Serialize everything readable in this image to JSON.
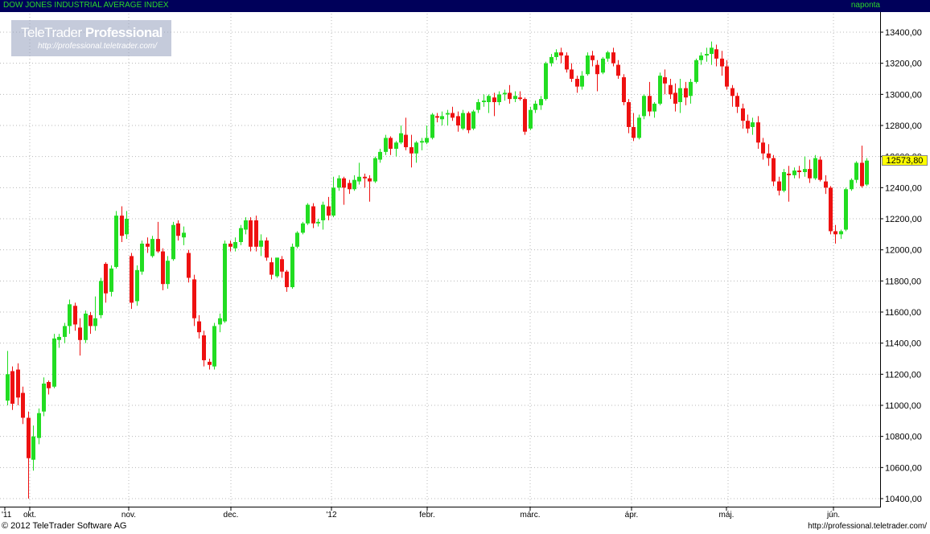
{
  "header": {
    "title": "DOW JONES INDUSTRIAL AVERAGE INDEX",
    "interval": "naponta"
  },
  "watermark": {
    "brand_plain": "TeleTrader",
    "brand_bold": "Professional",
    "url": "http://professional.teletrader.com/"
  },
  "footer": {
    "copyright": "© 2012 TeleTrader Software AG",
    "url": "http://professional.teletrader.com/"
  },
  "colors": {
    "up": "#22dd22",
    "down": "#ee1111",
    "grid": "#b8b8b8",
    "header_bg": "#00005a",
    "header_text": "#2bd62b",
    "last_price_bg": "#ffff00"
  },
  "chart_data": {
    "type": "candlestick",
    "title": "DOW JONES INDUSTRIAL AVERAGE INDEX",
    "ylim": [
      10400,
      13500
    ],
    "y_ticks": [
      "13400,00",
      "13200,00",
      "13000,00",
      "12800,00",
      "12600,00",
      "12400,00",
      "12200,00",
      "12000,00",
      "11800,00",
      "11600,00",
      "11400,00",
      "11200,00",
      "11000,00",
      "10800,00",
      "10600,00",
      "10400,00"
    ],
    "x_labels": [
      "'11",
      "okt.",
      "nov.",
      "dec.",
      "'12",
      "febr.",
      "márc.",
      "ápr.",
      "máj.",
      "jún."
    ],
    "last_price": "12573,80",
    "grid": true,
    "candles": [
      {
        "o": 11030,
        "h": 11350,
        "l": 11000,
        "c": 11200
      },
      {
        "o": 11220,
        "h": 11250,
        "l": 10970,
        "c": 11010
      },
      {
        "o": 11230,
        "h": 11270,
        "l": 11000,
        "c": 11050
      },
      {
        "o": 11080,
        "h": 11120,
        "l": 10880,
        "c": 10920
      },
      {
        "o": 10920,
        "h": 10960,
        "l": 10400,
        "c": 10660
      },
      {
        "o": 10650,
        "h": 10870,
        "l": 10580,
        "c": 10800
      },
      {
        "o": 10790,
        "h": 10980,
        "l": 10750,
        "c": 10950
      },
      {
        "o": 10960,
        "h": 11180,
        "l": 10930,
        "c": 11140
      },
      {
        "o": 11150,
        "h": 11160,
        "l": 11070,
        "c": 11110
      },
      {
        "o": 11120,
        "h": 11460,
        "l": 11110,
        "c": 11430
      },
      {
        "o": 11420,
        "h": 11460,
        "l": 11370,
        "c": 11440
      },
      {
        "o": 11440,
        "h": 11530,
        "l": 11400,
        "c": 11510
      },
      {
        "o": 11510,
        "h": 11680,
        "l": 11460,
        "c": 11650
      },
      {
        "o": 11640,
        "h": 11660,
        "l": 11480,
        "c": 11520
      },
      {
        "o": 11500,
        "h": 11560,
        "l": 11320,
        "c": 11420
      },
      {
        "o": 11420,
        "h": 11610,
        "l": 11400,
        "c": 11590
      },
      {
        "o": 11580,
        "h": 11600,
        "l": 11460,
        "c": 11510
      },
      {
        "o": 11510,
        "h": 11700,
        "l": 11480,
        "c": 11560
      },
      {
        "o": 11580,
        "h": 11820,
        "l": 11560,
        "c": 11800
      },
      {
        "o": 11910,
        "h": 11920,
        "l": 11660,
        "c": 11720
      },
      {
        "o": 11730,
        "h": 11900,
        "l": 11700,
        "c": 11880
      },
      {
        "o": 11890,
        "h": 12250,
        "l": 11880,
        "c": 12220
      },
      {
        "o": 12220,
        "h": 12280,
        "l": 12050,
        "c": 12090
      },
      {
        "o": 12100,
        "h": 12250,
        "l": 12070,
        "c": 12200
      },
      {
        "o": 11960,
        "h": 11980,
        "l": 11620,
        "c": 11660
      },
      {
        "o": 11670,
        "h": 11900,
        "l": 11640,
        "c": 11870
      },
      {
        "o": 11860,
        "h": 12060,
        "l": 11840,
        "c": 12040
      },
      {
        "o": 12040,
        "h": 12080,
        "l": 11980,
        "c": 12020
      },
      {
        "o": 11960,
        "h": 12090,
        "l": 11950,
        "c": 12070
      },
      {
        "o": 12070,
        "h": 12180,
        "l": 11980,
        "c": 11990
      },
      {
        "o": 11990,
        "h": 12010,
        "l": 11740,
        "c": 11780
      },
      {
        "o": 11780,
        "h": 11960,
        "l": 11750,
        "c": 11930
      },
      {
        "o": 11940,
        "h": 12180,
        "l": 11930,
        "c": 12160
      },
      {
        "o": 12170,
        "h": 12190,
        "l": 12060,
        "c": 12090
      },
      {
        "o": 12080,
        "h": 12150,
        "l": 12030,
        "c": 12110
      },
      {
        "o": 11980,
        "h": 12000,
        "l": 11790,
        "c": 11820
      },
      {
        "o": 11810,
        "h": 11840,
        "l": 11510,
        "c": 11560
      },
      {
        "o": 11540,
        "h": 11580,
        "l": 11430,
        "c": 11470
      },
      {
        "o": 11450,
        "h": 11480,
        "l": 11250,
        "c": 11290
      },
      {
        "o": 11280,
        "h": 11300,
        "l": 11230,
        "c": 11260
      },
      {
        "o": 11250,
        "h": 11530,
        "l": 11230,
        "c": 11510
      },
      {
        "o": 11520,
        "h": 11590,
        "l": 11470,
        "c": 11560
      },
      {
        "o": 11540,
        "h": 12060,
        "l": 11530,
        "c": 12040
      },
      {
        "o": 12040,
        "h": 12060,
        "l": 11990,
        "c": 12020
      },
      {
        "o": 12010,
        "h": 12080,
        "l": 11990,
        "c": 12050
      },
      {
        "o": 12050,
        "h": 12160,
        "l": 12030,
        "c": 12140
      },
      {
        "o": 12130,
        "h": 12210,
        "l": 12100,
        "c": 12190
      },
      {
        "o": 12190,
        "h": 12210,
        "l": 11990,
        "c": 12020
      },
      {
        "o": 12190,
        "h": 12220,
        "l": 11990,
        "c": 12020
      },
      {
        "o": 12020,
        "h": 12100,
        "l": 11960,
        "c": 12060
      },
      {
        "o": 12060,
        "h": 12080,
        "l": 11930,
        "c": 11950
      },
      {
        "o": 11920,
        "h": 11950,
        "l": 11810,
        "c": 11840
      },
      {
        "o": 11830,
        "h": 11950,
        "l": 11820,
        "c": 11950
      },
      {
        "o": 11940,
        "h": 11960,
        "l": 11820,
        "c": 11860
      },
      {
        "o": 11860,
        "h": 11870,
        "l": 11730,
        "c": 11760
      },
      {
        "o": 11760,
        "h": 12040,
        "l": 11750,
        "c": 12020
      },
      {
        "o": 12020,
        "h": 12120,
        "l": 12010,
        "c": 12110
      },
      {
        "o": 12110,
        "h": 12180,
        "l": 12100,
        "c": 12170
      },
      {
        "o": 12170,
        "h": 12300,
        "l": 12160,
        "c": 12290
      },
      {
        "o": 12280,
        "h": 12300,
        "l": 12140,
        "c": 12170
      },
      {
        "o": 12170,
        "h": 12200,
        "l": 12150,
        "c": 12180
      },
      {
        "o": 12190,
        "h": 12310,
        "l": 12130,
        "c": 12290
      },
      {
        "o": 12280,
        "h": 12340,
        "l": 12190,
        "c": 12220
      },
      {
        "o": 12220,
        "h": 12470,
        "l": 12210,
        "c": 12400
      },
      {
        "o": 12400,
        "h": 12480,
        "l": 12380,
        "c": 12460
      },
      {
        "o": 12460,
        "h": 12470,
        "l": 12290,
        "c": 12400
      },
      {
        "o": 12430,
        "h": 12450,
        "l": 12360,
        "c": 12390
      },
      {
        "o": 12390,
        "h": 12480,
        "l": 12380,
        "c": 12450
      },
      {
        "o": 12440,
        "h": 12560,
        "l": 12420,
        "c": 12470
      },
      {
        "o": 12470,
        "h": 12490,
        "l": 12400,
        "c": 12460
      },
      {
        "o": 12460,
        "h": 12480,
        "l": 12310,
        "c": 12440
      },
      {
        "o": 12440,
        "h": 12600,
        "l": 12430,
        "c": 12590
      },
      {
        "o": 12580,
        "h": 12650,
        "l": 12560,
        "c": 12630
      },
      {
        "o": 12630,
        "h": 12740,
        "l": 12610,
        "c": 12720
      },
      {
        "o": 12720,
        "h": 12730,
        "l": 12610,
        "c": 12650
      },
      {
        "o": 12650,
        "h": 12700,
        "l": 12600,
        "c": 12690
      },
      {
        "o": 12690,
        "h": 12800,
        "l": 12680,
        "c": 12750
      },
      {
        "o": 12740,
        "h": 12850,
        "l": 12640,
        "c": 12660
      },
      {
        "o": 12660,
        "h": 12740,
        "l": 12530,
        "c": 12620
      },
      {
        "o": 12620,
        "h": 12700,
        "l": 12560,
        "c": 12690
      },
      {
        "o": 12690,
        "h": 12720,
        "l": 12640,
        "c": 12700
      },
      {
        "o": 12690,
        "h": 12800,
        "l": 12680,
        "c": 12720
      },
      {
        "o": 12720,
        "h": 12880,
        "l": 12710,
        "c": 12870
      },
      {
        "o": 12860,
        "h": 12880,
        "l": 12820,
        "c": 12850
      },
      {
        "o": 12840,
        "h": 12890,
        "l": 12800,
        "c": 12860
      },
      {
        "o": 12870,
        "h": 12900,
        "l": 12800,
        "c": 12880
      },
      {
        "o": 12880,
        "h": 12920,
        "l": 12830,
        "c": 12850
      },
      {
        "o": 12860,
        "h": 12890,
        "l": 12760,
        "c": 12800
      },
      {
        "o": 12780,
        "h": 12900,
        "l": 12770,
        "c": 12880
      },
      {
        "o": 12880,
        "h": 12890,
        "l": 12750,
        "c": 12770
      },
      {
        "o": 12780,
        "h": 12900,
        "l": 12770,
        "c": 12890
      },
      {
        "o": 12900,
        "h": 12970,
        "l": 12880,
        "c": 12950
      },
      {
        "o": 12950,
        "h": 13000,
        "l": 12920,
        "c": 12960
      },
      {
        "o": 12950,
        "h": 13000,
        "l": 12880,
        "c": 12990
      },
      {
        "o": 12980,
        "h": 13010,
        "l": 12860,
        "c": 12950
      },
      {
        "o": 12950,
        "h": 13020,
        "l": 12930,
        "c": 13000
      },
      {
        "o": 13000,
        "h": 13030,
        "l": 12960,
        "c": 13010
      },
      {
        "o": 13010,
        "h": 13060,
        "l": 12940,
        "c": 12970
      },
      {
        "o": 12970,
        "h": 13020,
        "l": 12950,
        "c": 12990
      },
      {
        "o": 12980,
        "h": 13020,
        "l": 12960,
        "c": 12970
      },
      {
        "o": 12970,
        "h": 12980,
        "l": 12740,
        "c": 12760
      },
      {
        "o": 12780,
        "h": 12920,
        "l": 12770,
        "c": 12900
      },
      {
        "o": 12900,
        "h": 12960,
        "l": 12880,
        "c": 12940
      },
      {
        "o": 12930,
        "h": 12990,
        "l": 12900,
        "c": 12970
      },
      {
        "o": 12970,
        "h": 13210,
        "l": 12960,
        "c": 13200
      },
      {
        "o": 13200,
        "h": 13260,
        "l": 13180,
        "c": 13240
      },
      {
        "o": 13240,
        "h": 13290,
        "l": 13220,
        "c": 13270
      },
      {
        "o": 13270,
        "h": 13300,
        "l": 13200,
        "c": 13250
      },
      {
        "o": 13250,
        "h": 13270,
        "l": 13140,
        "c": 13160
      },
      {
        "o": 13160,
        "h": 13200,
        "l": 13080,
        "c": 13100
      },
      {
        "o": 13100,
        "h": 13120,
        "l": 13010,
        "c": 13050
      },
      {
        "o": 13050,
        "h": 13150,
        "l": 13030,
        "c": 13120
      },
      {
        "o": 13130,
        "h": 13270,
        "l": 13120,
        "c": 13250
      },
      {
        "o": 13250,
        "h": 13280,
        "l": 13180,
        "c": 13220
      },
      {
        "o": 13190,
        "h": 13220,
        "l": 13020,
        "c": 13130
      },
      {
        "o": 13140,
        "h": 13240,
        "l": 13130,
        "c": 13230
      },
      {
        "o": 13230,
        "h": 13280,
        "l": 13210,
        "c": 13270
      },
      {
        "o": 13270,
        "h": 13300,
        "l": 13180,
        "c": 13200
      },
      {
        "o": 13190,
        "h": 13220,
        "l": 13100,
        "c": 13120
      },
      {
        "o": 13110,
        "h": 13130,
        "l": 12930,
        "c": 12950
      },
      {
        "o": 12950,
        "h": 12970,
        "l": 12750,
        "c": 12790
      },
      {
        "o": 12790,
        "h": 12880,
        "l": 12700,
        "c": 12720
      },
      {
        "o": 12720,
        "h": 12870,
        "l": 12710,
        "c": 12850
      },
      {
        "o": 12860,
        "h": 13000,
        "l": 12840,
        "c": 12990
      },
      {
        "o": 12990,
        "h": 13080,
        "l": 12860,
        "c": 12890
      },
      {
        "o": 12890,
        "h": 12950,
        "l": 12850,
        "c": 12940
      },
      {
        "o": 12940,
        "h": 13140,
        "l": 12930,
        "c": 13120
      },
      {
        "o": 13110,
        "h": 13160,
        "l": 13000,
        "c": 13070
      },
      {
        "o": 13060,
        "h": 13100,
        "l": 12970,
        "c": 13000
      },
      {
        "o": 13010,
        "h": 13070,
        "l": 12890,
        "c": 12940
      },
      {
        "o": 12950,
        "h": 13100,
        "l": 12880,
        "c": 13040
      },
      {
        "o": 13040,
        "h": 13080,
        "l": 12930,
        "c": 12980
      },
      {
        "o": 12990,
        "h": 13100,
        "l": 12940,
        "c": 13080
      },
      {
        "o": 13080,
        "h": 13230,
        "l": 13070,
        "c": 13220
      },
      {
        "o": 13220,
        "h": 13270,
        "l": 13190,
        "c": 13250
      },
      {
        "o": 13250,
        "h": 13300,
        "l": 13210,
        "c": 13260
      },
      {
        "o": 13260,
        "h": 13340,
        "l": 13190,
        "c": 13300
      },
      {
        "o": 13290,
        "h": 13320,
        "l": 13180,
        "c": 13230
      },
      {
        "o": 13230,
        "h": 13280,
        "l": 13120,
        "c": 13180
      },
      {
        "o": 13180,
        "h": 13220,
        "l": 13030,
        "c": 13050
      },
      {
        "o": 13040,
        "h": 13060,
        "l": 12920,
        "c": 12990
      },
      {
        "o": 12990,
        "h": 13010,
        "l": 12880,
        "c": 12920
      },
      {
        "o": 12910,
        "h": 12940,
        "l": 12780,
        "c": 12830
      },
      {
        "o": 12830,
        "h": 12870,
        "l": 12750,
        "c": 12780
      },
      {
        "o": 12790,
        "h": 12850,
        "l": 12740,
        "c": 12820
      },
      {
        "o": 12820,
        "h": 12860,
        "l": 12650,
        "c": 12690
      },
      {
        "o": 12690,
        "h": 12720,
        "l": 12580,
        "c": 12620
      },
      {
        "o": 12620,
        "h": 12680,
        "l": 12540,
        "c": 12590
      },
      {
        "o": 12590,
        "h": 12610,
        "l": 12410,
        "c": 12440
      },
      {
        "o": 12440,
        "h": 12470,
        "l": 12350,
        "c": 12380
      },
      {
        "o": 12380,
        "h": 12520,
        "l": 12370,
        "c": 12500
      },
      {
        "o": 12490,
        "h": 12540,
        "l": 12310,
        "c": 12480
      },
      {
        "o": 12480,
        "h": 12530,
        "l": 12460,
        "c": 12510
      },
      {
        "o": 12510,
        "h": 12540,
        "l": 12460,
        "c": 12500
      },
      {
        "o": 12500,
        "h": 12600,
        "l": 12470,
        "c": 12520
      },
      {
        "o": 12520,
        "h": 12580,
        "l": 12430,
        "c": 12460
      },
      {
        "o": 12460,
        "h": 12610,
        "l": 12450,
        "c": 12590
      },
      {
        "o": 12580,
        "h": 12600,
        "l": 12440,
        "c": 12450
      },
      {
        "o": 12440,
        "h": 12480,
        "l": 12360,
        "c": 12400
      },
      {
        "o": 12400,
        "h": 12410,
        "l": 12100,
        "c": 12120
      },
      {
        "o": 12120,
        "h": 12160,
        "l": 12040,
        "c": 12100
      },
      {
        "o": 12100,
        "h": 12130,
        "l": 12070,
        "c": 12120
      },
      {
        "o": 12130,
        "h": 12400,
        "l": 12120,
        "c": 12390
      },
      {
        "o": 12390,
        "h": 12460,
        "l": 12380,
        "c": 12450
      },
      {
        "o": 12450,
        "h": 12570,
        "l": 12430,
        "c": 12560
      },
      {
        "o": 12560,
        "h": 12670,
        "l": 12400,
        "c": 12410
      },
      {
        "o": 12420,
        "h": 12590,
        "l": 12410,
        "c": 12574
      }
    ]
  }
}
